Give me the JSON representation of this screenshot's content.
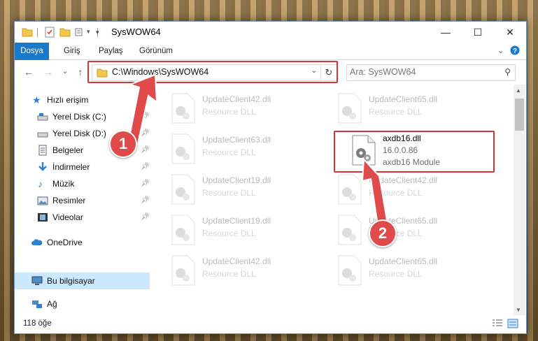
{
  "window": {
    "title": "SysWOW64",
    "controls": {
      "minimize": "—",
      "maximize": "☐",
      "close": "✕"
    }
  },
  "ribbon": {
    "tabs": [
      "Dosya",
      "Giriş",
      "Paylaş",
      "Görünüm"
    ],
    "expand_icon": "chevron-down-icon",
    "help_icon": "help-icon"
  },
  "nav": {
    "back": "←",
    "forward": "→",
    "recent": "⌄",
    "up": "↑",
    "address": "C:\\Windows\\SysWOW64",
    "search_placeholder": "Ara: SysWOW64"
  },
  "sidebar": {
    "items": [
      {
        "label": "Hızlı erişim",
        "icon": "star-icon",
        "pinned": false
      },
      {
        "label": "Yerel Disk (C:)",
        "icon": "drive-icon",
        "pinned": true
      },
      {
        "label": "Yerel Disk (D:)",
        "icon": "drive-icon",
        "pinned": true
      },
      {
        "label": "Belgeler",
        "icon": "documents-icon",
        "pinned": true
      },
      {
        "label": "İndirmeler",
        "icon": "download-icon",
        "pinned": true
      },
      {
        "label": "Müzik",
        "icon": "music-icon",
        "pinned": true
      },
      {
        "label": "Resimler",
        "icon": "pictures-icon",
        "pinned": true
      },
      {
        "label": "Videolar",
        "icon": "videos-icon",
        "pinned": true
      },
      {
        "label": "OneDrive",
        "icon": "cloud-icon",
        "pinned": false
      },
      {
        "label": "Bu bilgisayar",
        "icon": "computer-icon",
        "pinned": false,
        "selected": true
      },
      {
        "label": "Ağ",
        "icon": "network-icon",
        "pinned": false
      }
    ]
  },
  "files": [
    {
      "name": "UpdateClient42.dll",
      "type": "Resource DLL",
      "faded": true
    },
    {
      "name": "UpdateClient65.dll",
      "type": "Resource DLL",
      "faded": true
    },
    {
      "name": "UpdateClient63.dll",
      "type": "Resource DLL",
      "faded": true
    },
    {
      "name": "axdb16.dll",
      "version": "16.0.0.86",
      "type": "axdb16 Module",
      "faded": false
    },
    {
      "name": "UpdateClient19.dll",
      "type": "Resource DLL",
      "faded": true
    },
    {
      "name": "UpdateClient42.dll",
      "type": "Resource DLL",
      "faded": true
    },
    {
      "name": "UpdateClient19.dll",
      "type": "Resource DLL",
      "faded": true
    },
    {
      "name": "UpdateClient65.dll",
      "type": "Resource DLL",
      "faded": true
    },
    {
      "name": "UpdateClient42.dll",
      "type": "Resource DLL",
      "faded": true
    },
    {
      "name": "UpdateClient65.dll",
      "type": "Resource DLL",
      "faded": true
    }
  ],
  "status": {
    "item_count": "118 öğe"
  },
  "callouts": {
    "step1": "1",
    "step2": "2",
    "color": "#e04a4a"
  },
  "colors": {
    "accent": "#1979ca",
    "highlight": "#d9343b",
    "selected_bg": "#cce8ff"
  }
}
